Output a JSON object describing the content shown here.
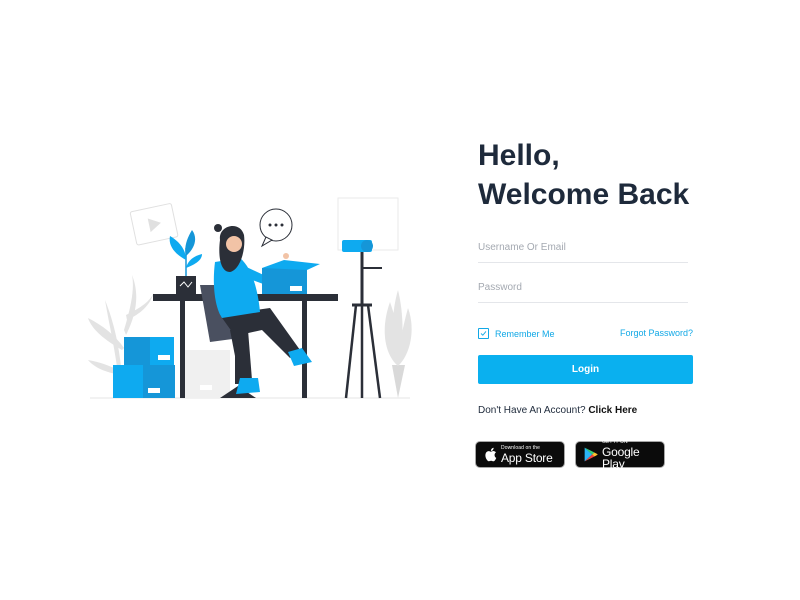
{
  "greeting": {
    "line1": "Hello,",
    "line2": "Welcome Back"
  },
  "form": {
    "username_placeholder": "Username Or Email",
    "username_value": "",
    "password_placeholder": "Password",
    "password_value": "",
    "remember_label": "Remember Me",
    "remember_checked": true,
    "forgot_label": "Forgot Password?",
    "login_label": "Login"
  },
  "signup": {
    "prompt": "Don't Have An Account?",
    "link_label": "Click Here"
  },
  "badges": {
    "appstore": {
      "small": "Download on the",
      "big": "App Store",
      "icon": "apple-icon"
    },
    "googleplay": {
      "small": "GET IT ON",
      "big": "Google Play",
      "icon": "google-play-icon"
    }
  },
  "colors": {
    "accent": "#0ab0ef",
    "heading": "#1e2a3b",
    "link": "#11a8e6"
  }
}
